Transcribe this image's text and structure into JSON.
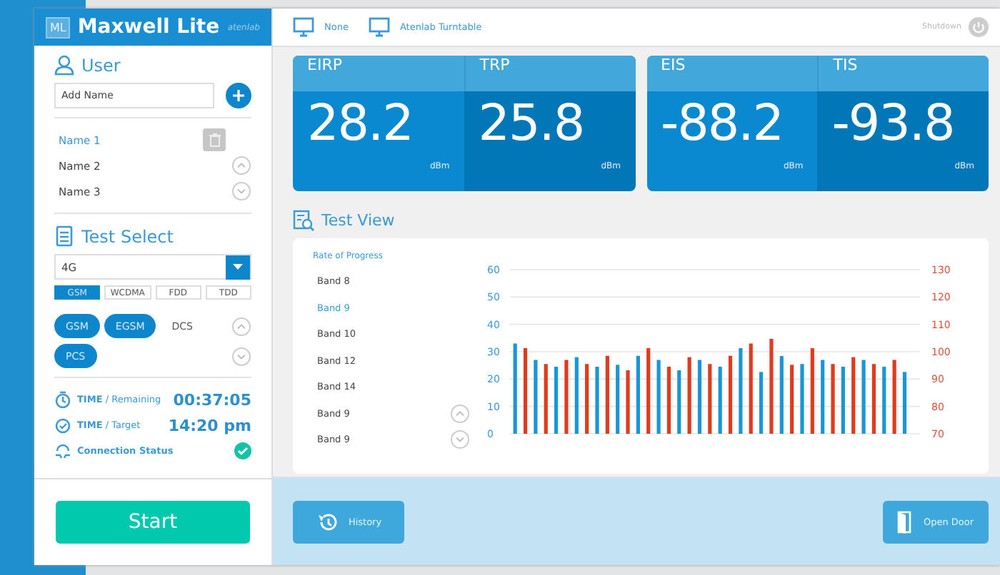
{
  "sidebar": {
    "logo_badge": "ML",
    "app_name": "Maxwell Lite",
    "brand": "atenlab",
    "user": {
      "title": "User",
      "name_field": {
        "placeholder": "Add Name"
      },
      "names": [
        {
          "label": "Name 1",
          "selected": true
        },
        {
          "label": "Name 2",
          "selected": false
        },
        {
          "label": "Name 3",
          "selected": false
        }
      ]
    },
    "test_select": {
      "title": "Test Select",
      "dropdown": "4G",
      "modes": [
        {
          "label": "GSM",
          "selected": true
        },
        {
          "label": "WCDMA",
          "selected": false
        },
        {
          "label": "FDD",
          "selected": false
        },
        {
          "label": "TDD",
          "selected": false
        }
      ],
      "bands": [
        {
          "label": "GSM",
          "selected": true
        },
        {
          "label": "EGSM",
          "selected": true
        },
        {
          "label": "DCS",
          "selected": false
        },
        {
          "label": "PCS",
          "selected": true
        }
      ]
    },
    "status": [
      {
        "kind": "remaining",
        "label": "TIME",
        "sublabel": "/ Remaining",
        "value": "00:37:05"
      },
      {
        "kind": "target",
        "label": "TIME",
        "sublabel": "/ Target",
        "value": "14:20 pm"
      },
      {
        "kind": "connection",
        "label": "Connection Status",
        "connected": true
      }
    ],
    "start_button": "Start"
  },
  "top_bar": {
    "devices": [
      "None",
      "Atenlab Turntable"
    ],
    "shutdown": "Shutdown"
  },
  "metrics": [
    [
      {
        "label": "EIRP",
        "value": "28.2",
        "unit": "dBm"
      },
      {
        "label": "TRP",
        "value": "25.8",
        "unit": "dBm"
      }
    ],
    [
      {
        "label": "EIS",
        "value": "-88.2",
        "unit": "dBm"
      },
      {
        "label": "TIS",
        "value": "-93.8",
        "unit": "dBm"
      }
    ]
  ],
  "test_view": {
    "title": "Test View",
    "progress_label": "Rate of Progress",
    "bands": [
      {
        "label": "Band 8",
        "selected": false
      },
      {
        "label": "Band 9",
        "selected": true
      },
      {
        "label": "Band 10",
        "selected": false
      },
      {
        "label": "Band 12",
        "selected": false
      },
      {
        "label": "Band 14",
        "selected": false
      },
      {
        "label": "Band 9",
        "selected": false
      },
      {
        "label": "Band 9",
        "selected": false
      }
    ],
    "chart_data": {
      "type": "bar",
      "grid": true,
      "ylim": [
        0,
        60
      ],
      "yticks": [
        0,
        10,
        20,
        30,
        40,
        50,
        60
      ],
      "y2lim": [
        70,
        130
      ],
      "y2ticks": [
        70,
        80,
        90,
        100,
        110,
        120,
        130
      ],
      "series": [
        {
          "color": "#1a96d8",
          "values": [
            33,
            27,
            24.5,
            28,
            24.5,
            25.2,
            28.5,
            27,
            23.2,
            27,
            24.5,
            31.3,
            22.6,
            28.4,
            25.5,
            27,
            24.5,
            27,
            24.5,
            22.6
          ]
        },
        {
          "color": "#e23a1c",
          "axis": "y2",
          "values": [
            101.3,
            95.5,
            97,
            95.5,
            98.5,
            93.2,
            101.3,
            94.5,
            98,
            95.5,
            98.5,
            103,
            104.7,
            95.2,
            101.3,
            95.5,
            98,
            95.5,
            97,
            null
          ]
        }
      ]
    }
  },
  "bottom_bar": {
    "history": "History",
    "open_door": "Open Door"
  }
}
